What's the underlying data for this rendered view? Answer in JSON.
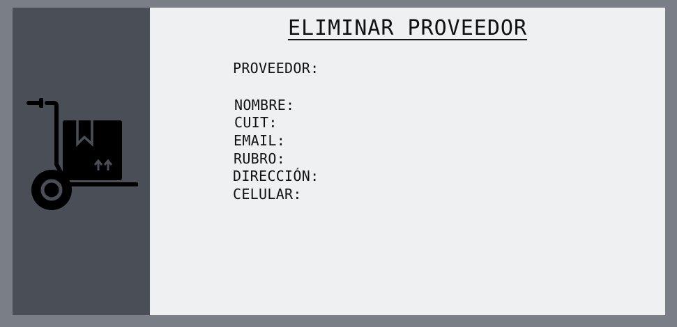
{
  "form": {
    "title": "ELIMINAR PROVEEDOR",
    "proveedor_label": "PROVEEDOR:",
    "fields": {
      "nombre": "NOMBRE:",
      "cuit": "CUIT:",
      "email": "EMAIL:",
      "rubro": "RUBRO:",
      "direccion": "DIRECCIÓN:",
      "celular": "CELULAR:"
    }
  },
  "sidebar": {
    "icon": "hand-truck-box-icon"
  },
  "colors": {
    "background": "#7a7f87",
    "sidebar": "#4a4e57",
    "panel": "#eff0f2"
  }
}
